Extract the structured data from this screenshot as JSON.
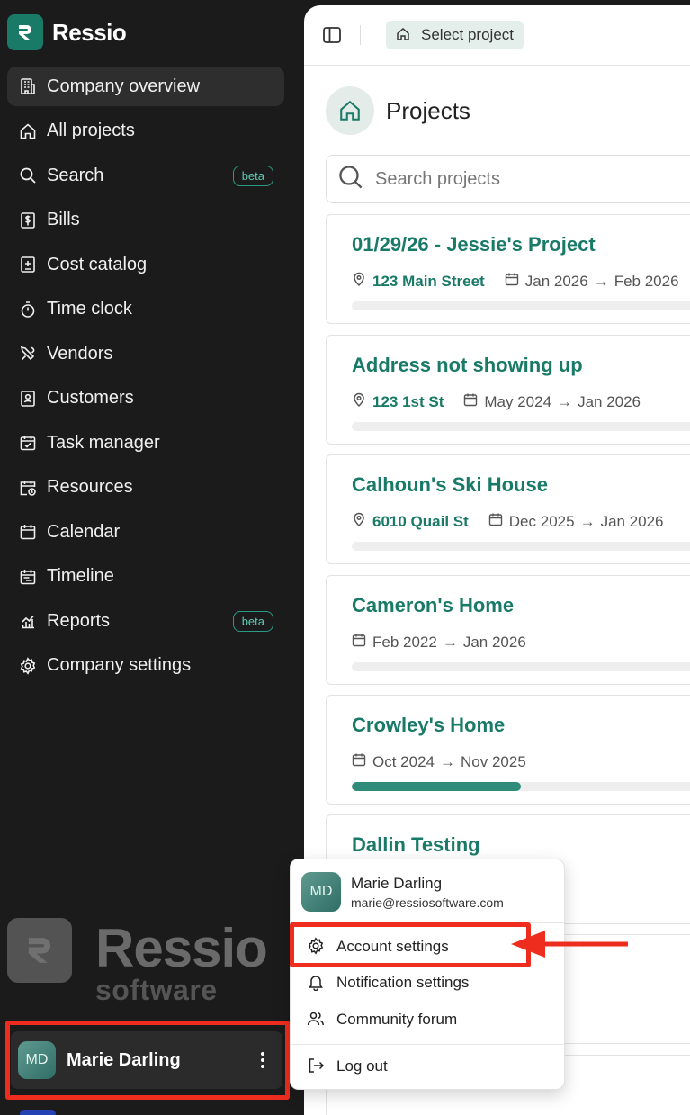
{
  "brand": {
    "name": "Ressio",
    "accent": "#1a7a68"
  },
  "sidebar": {
    "items": [
      {
        "label": "Company overview",
        "icon": "building-icon",
        "active": true
      },
      {
        "label": "All projects",
        "icon": "home-icon"
      },
      {
        "label": "Search",
        "icon": "search-icon",
        "badge": "beta"
      },
      {
        "label": "Bills",
        "icon": "bill-icon"
      },
      {
        "label": "Cost catalog",
        "icon": "catalog-icon"
      },
      {
        "label": "Time clock",
        "icon": "stopwatch-icon"
      },
      {
        "label": "Vendors",
        "icon": "tools-icon"
      },
      {
        "label": "Customers",
        "icon": "contact-card-icon"
      },
      {
        "label": "Task manager",
        "icon": "calendar-check-icon"
      },
      {
        "label": "Resources",
        "icon": "calendar-clock-icon"
      },
      {
        "label": "Calendar",
        "icon": "calendar-icon"
      },
      {
        "label": "Timeline",
        "icon": "timeline-icon"
      },
      {
        "label": "Reports",
        "icon": "chart-icon",
        "badge": "beta"
      },
      {
        "label": "Company settings",
        "icon": "gear-icon"
      }
    ],
    "watermark": {
      "big": "Ressio",
      "small": "software"
    },
    "user": {
      "initials": "MD",
      "name": "Marie Darling"
    }
  },
  "topbar": {
    "select_project": "Select project"
  },
  "page": {
    "title": "Projects"
  },
  "search": {
    "placeholder": "Search projects"
  },
  "projects": [
    {
      "title": "01/29/26 - Jessie's Project",
      "address": "123 Main Street",
      "start": "Jan 2026",
      "end": "Feb 2026",
      "progress": 0
    },
    {
      "title": "Address not showing up",
      "address": "123 1st St",
      "start": "May 2024",
      "end": "Jan 2026",
      "progress": 0
    },
    {
      "title": "Calhoun's Ski House",
      "address": "6010 Quail St",
      "start": "Dec 2025",
      "end": "Jan 2026",
      "progress": 0
    },
    {
      "title": "Cameron's Home",
      "start": "Feb 2022",
      "end": "Jan 2026",
      "progress": 0
    },
    {
      "title": "Crowley's Home",
      "start": "Oct 2024",
      "end": "Nov 2025",
      "progress": 0.48
    },
    {
      "title": "Dallin Testing"
    }
  ],
  "user_menu": {
    "initials": "MD",
    "name": "Marie Darling",
    "email": "marie@ressiosoftware.com",
    "items": [
      {
        "label": "Account settings",
        "icon": "gear-icon"
      },
      {
        "label": "Notification settings",
        "icon": "bell-icon"
      },
      {
        "label": "Community forum",
        "icon": "users-icon"
      },
      {
        "label": "Log out",
        "icon": "logout-icon"
      }
    ]
  },
  "annotation_color": "#ee2d1f"
}
